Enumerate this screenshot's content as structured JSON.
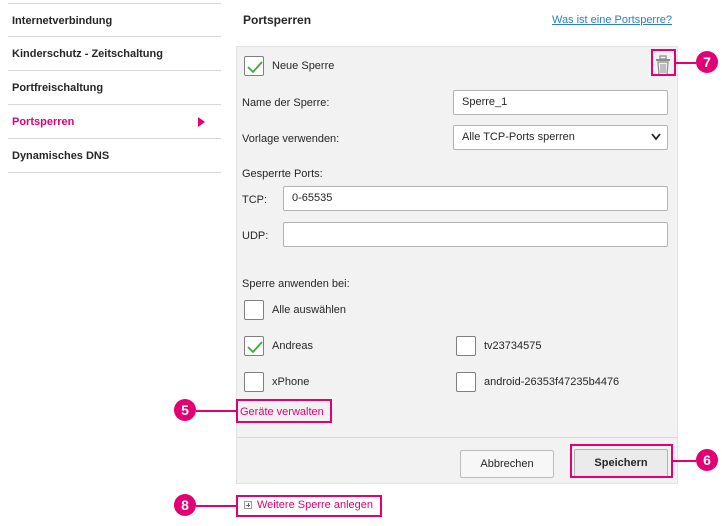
{
  "sidebar": {
    "items": [
      {
        "label": "Internetverbindung"
      },
      {
        "label": "Kinderschutz - Zeitschaltung"
      },
      {
        "label": "Portfreischaltung"
      },
      {
        "label": "Portsperren"
      },
      {
        "label": "Dynamisches DNS"
      }
    ],
    "active_index": 3
  },
  "panel": {
    "title": "Portsperren",
    "help_link": "Was ist eine Portsperre?"
  },
  "rule": {
    "new_rule_label": "Neue Sperre",
    "new_rule_checked": true,
    "name_label": "Name der Sperre:",
    "name_value": "Sperre_1",
    "template_label": "Vorlage verwenden:",
    "template_value": "Alle TCP-Ports sperren",
    "blocked_ports_label": "Gesperrte Ports:",
    "tcp_label": "TCP:",
    "tcp_value": "0-65535",
    "udp_label": "UDP:",
    "udp_value": ""
  },
  "apply": {
    "label": "Sperre anwenden bei:",
    "select_all_label": "Alle auswählen",
    "select_all_checked": false,
    "devices": [
      {
        "name": "Andreas",
        "checked": true
      },
      {
        "name": "tv23734575",
        "checked": false
      },
      {
        "name": "xPhone",
        "checked": false
      },
      {
        "name": "android-26353f47235b4476",
        "checked": false
      }
    ],
    "manage_devices_link": "Geräte verwalten"
  },
  "buttons": {
    "cancel": "Abbrechen",
    "save": "Speichern"
  },
  "add_rule_link": "Weitere Sperre anlegen",
  "markers": [
    "5",
    "6",
    "7",
    "8"
  ],
  "colors": {
    "accent": "#e20074",
    "link_blue": "#2c7fc4",
    "form_bg": "#f2f2f2",
    "check_green": "#3cab3c"
  }
}
